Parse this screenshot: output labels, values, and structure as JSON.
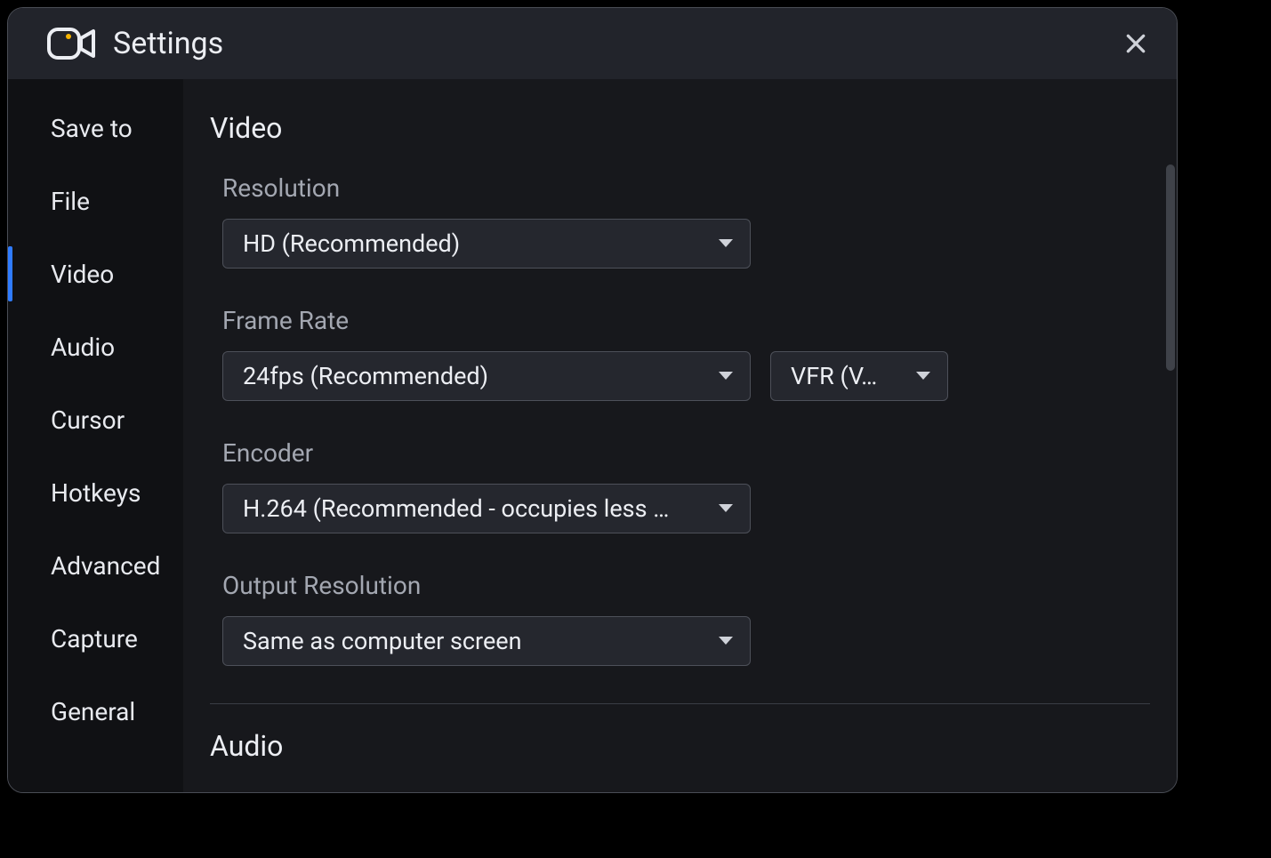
{
  "header": {
    "title": "Settings"
  },
  "sidebar": {
    "items": [
      {
        "label": "Save to"
      },
      {
        "label": "File"
      },
      {
        "label": "Video",
        "active": true
      },
      {
        "label": "Audio"
      },
      {
        "label": "Cursor"
      },
      {
        "label": "Hotkeys"
      },
      {
        "label": "Advanced"
      },
      {
        "label": "Capture"
      },
      {
        "label": "General"
      }
    ]
  },
  "content": {
    "section_title": "Video",
    "fields": {
      "resolution": {
        "label": "Resolution",
        "value": "HD (Recommended)"
      },
      "frame_rate": {
        "label": "Frame Rate",
        "value": "24fps (Recommended)",
        "mode": "VFR (V…"
      },
      "encoder": {
        "label": "Encoder",
        "value": "H.264 (Recommended - occupies less …"
      },
      "output_res": {
        "label": "Output Resolution",
        "value": "Same as computer screen"
      }
    },
    "next_section_title": "Audio"
  }
}
